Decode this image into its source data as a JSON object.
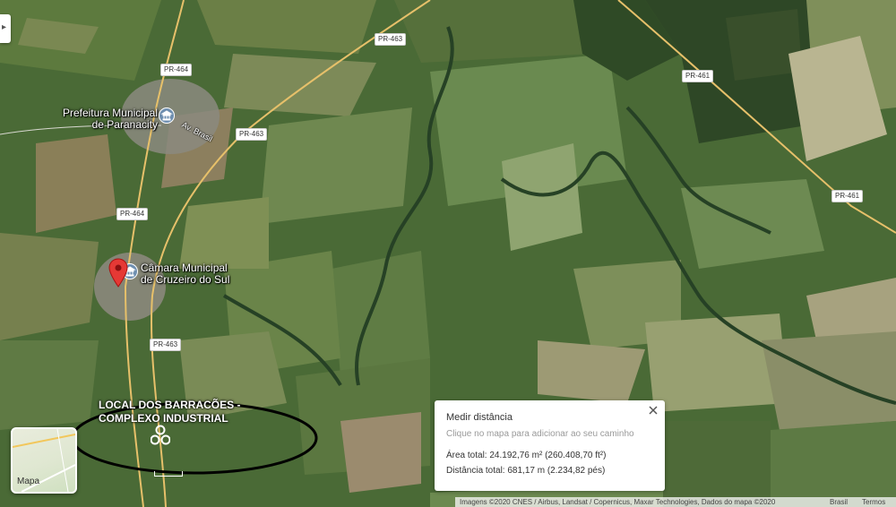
{
  "map": {
    "road_labels": [
      "PR-463",
      "PR-464",
      "PR-463",
      "PR-464",
      "PR-463",
      "PR-461",
      "PR-461"
    ],
    "street_label": "Av. Brasil",
    "pois": [
      {
        "line1": "Prefeitura Municipal",
        "line2": "de Paranacity",
        "icon": "city-hall-icon"
      },
      {
        "line1": "Câmara Municipal",
        "line2": "de Cruzeiro do Sul",
        "icon": "city-hall-icon"
      }
    ],
    "pin_icon": "location-pin-icon",
    "pin_color": "#e53935"
  },
  "annotation": {
    "line1": "LOCAL DOS BARRACÕES -",
    "line2": "COMPLEXO INDUSTRIAL",
    "ellipse_color": "#000000",
    "icon": "cluster-icon"
  },
  "layer_switcher": {
    "label": "Mapa"
  },
  "measure": {
    "title": "Medir distância",
    "hint": "Clique no mapa para adicionar ao seu caminho",
    "area": "Área total: 24.192,76 m² (260.408,70 ft²)",
    "distance": "Distância total: 681,17 m (2.234,82 pés)",
    "close_icon": "close-icon"
  },
  "footer": {
    "attribution": "Imagens ©2020 CNES / Airbus, Landsat / Copernicus, Maxar Technologies, Dados do mapa ©2020",
    "country": "Brasil",
    "terms": "Termos"
  },
  "collapse_icon": "chevron-right-icon"
}
